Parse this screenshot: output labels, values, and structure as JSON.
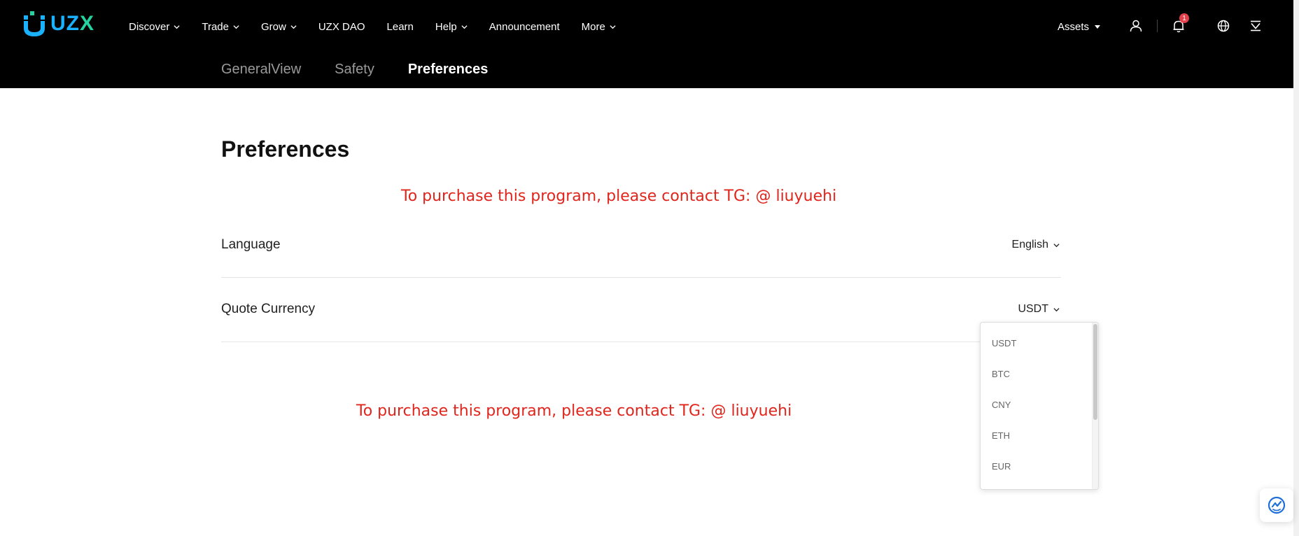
{
  "brand": {
    "name_main": "UZ",
    "name_accent": "X"
  },
  "nav": [
    {
      "label": "Discover",
      "dropdown": true
    },
    {
      "label": "Trade",
      "dropdown": true
    },
    {
      "label": "Grow",
      "dropdown": true
    },
    {
      "label": "UZX DAO",
      "dropdown": false
    },
    {
      "label": "Learn",
      "dropdown": false
    },
    {
      "label": "Help",
      "dropdown": true
    },
    {
      "label": "Announcement",
      "dropdown": false
    },
    {
      "label": "More",
      "dropdown": true
    }
  ],
  "header_right": {
    "assets_label": "Assets",
    "notification_count": "1",
    "icons": [
      "user-icon",
      "bell-icon",
      "globe-icon",
      "download-icon"
    ]
  },
  "subtabs": [
    {
      "label": "GeneralView",
      "active": false
    },
    {
      "label": "Safety",
      "active": false
    },
    {
      "label": "Preferences",
      "active": true
    }
  ],
  "page": {
    "title": "Preferences",
    "promo_text_1": "To purchase this program, please contact TG: @ liuyuehi",
    "promo_text_2": "To purchase this program, please contact TG: @ liuyuehi",
    "promo_color": "#e0251c"
  },
  "settings": {
    "language": {
      "label": "Language",
      "value": "English"
    },
    "quote_currency": {
      "label": "Quote Currency",
      "value": "USDT"
    }
  },
  "currency_dropdown": {
    "options": [
      "USDT",
      "BTC",
      "CNY",
      "ETH",
      "EUR"
    ]
  },
  "colors": {
    "topbar_bg": "#000000",
    "accent_blue": "#1ab2ff",
    "accent_green": "#25d3a0",
    "badge_red": "#e2404a"
  }
}
